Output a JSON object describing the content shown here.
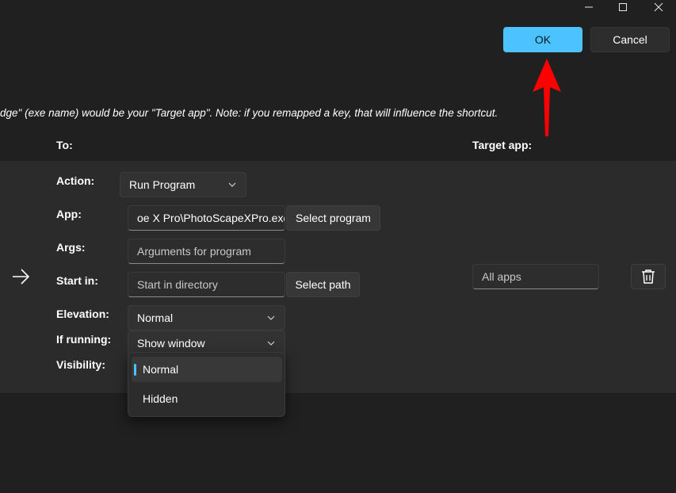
{
  "window": {
    "controls": [
      "minimize-icon",
      "maximize-icon",
      "close-icon"
    ]
  },
  "dialog": {
    "ok_label": "OK",
    "cancel_label": "Cancel",
    "note": "dge\" (exe name) would be your \"Target app\". Note: if you remapped a key, that will influence the shortcut."
  },
  "headers": {
    "to": "To:",
    "target_app": "Target app:"
  },
  "form": {
    "action_label": "Action:",
    "action_value": "Run Program",
    "app_label": "App:",
    "app_value": "oe X Pro\\PhotoScapeXPro.exe",
    "select_program_label": "Select program",
    "args_label": "Args:",
    "args_placeholder": "Arguments for program",
    "start_in_label": "Start in:",
    "start_in_placeholder": "Start in directory",
    "select_path_label": "Select path",
    "elevation_label": "Elevation:",
    "elevation_value": "Normal",
    "if_running_label": "If running:",
    "if_running_value": "Show window",
    "visibility_label": "Visibility:"
  },
  "visibility_dropdown": {
    "options": [
      "Normal",
      "Hidden"
    ],
    "selected": "Normal"
  },
  "target_app": {
    "placeholder": "All apps"
  },
  "colors": {
    "accent": "#4cc2ff",
    "annotation_arrow": "#ff0000",
    "background": "#202020",
    "panel": "#2b2b2b"
  },
  "icons": {
    "arrow": "arrow-right-icon",
    "delete": "trash-icon",
    "chevron": "chevron-down-icon",
    "annotation": "red-arrow-annotation-icon"
  }
}
